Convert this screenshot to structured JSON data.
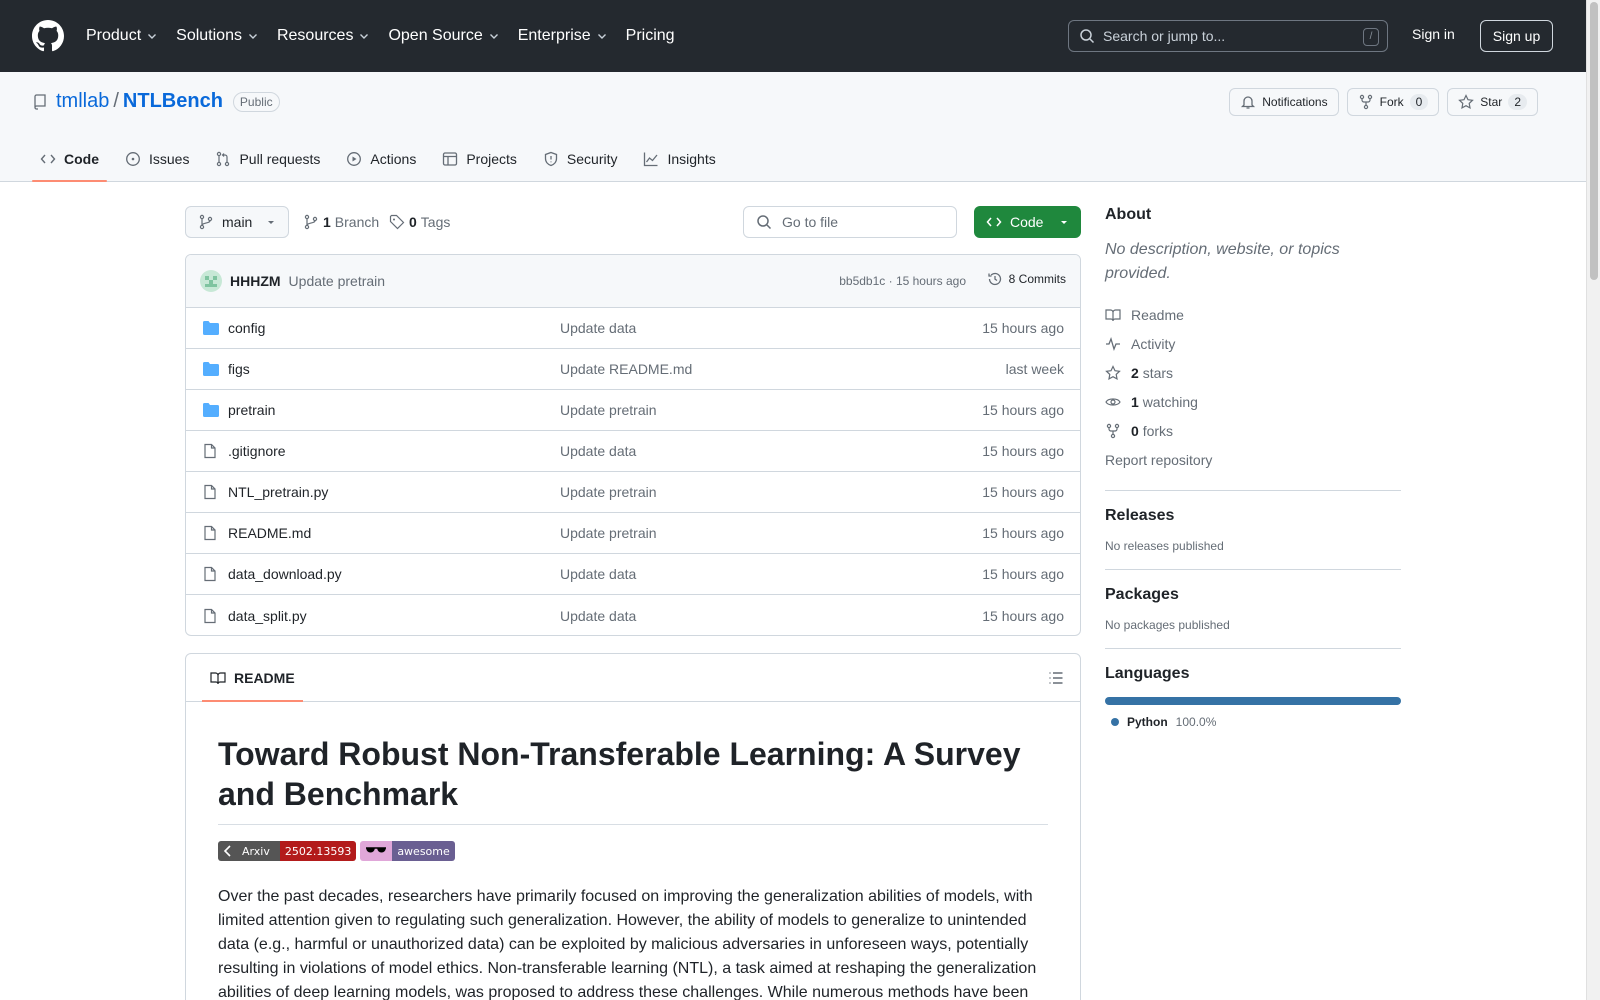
{
  "header": {
    "nav": [
      "Product",
      "Solutions",
      "Resources",
      "Open Source",
      "Enterprise",
      "Pricing"
    ],
    "search_placeholder": "Search or jump to...",
    "search_shortcut": "/",
    "signin": "Sign in",
    "signup": "Sign up"
  },
  "repo": {
    "owner": "tmllab",
    "sep": "/",
    "name": "NTLBench",
    "visibility": "Public",
    "notifications": "Notifications",
    "fork_label": "Fork",
    "fork_count": "0",
    "star_label": "Star",
    "star_count": "2",
    "tabs": [
      "Code",
      "Issues",
      "Pull requests",
      "Actions",
      "Projects",
      "Security",
      "Insights"
    ]
  },
  "toolbar": {
    "branch": "main",
    "branches_count": "1",
    "branches_label": "Branch",
    "tags_count": "0",
    "tags_label": "Tags",
    "goto_placeholder": "Go to file",
    "code_label": "Code"
  },
  "commit": {
    "author": "HHHZM",
    "message": "Update pretrain",
    "meta": "bb5db1c · 15 hours ago",
    "count": "8 Commits"
  },
  "files": [
    {
      "type": "dir",
      "name": "config",
      "msg": "Update data",
      "age": "15 hours ago"
    },
    {
      "type": "dir",
      "name": "figs",
      "msg": "Update README.md",
      "age": "last week"
    },
    {
      "type": "dir",
      "name": "pretrain",
      "msg": "Update pretrain",
      "age": "15 hours ago"
    },
    {
      "type": "file",
      "name": ".gitignore",
      "msg": "Update data",
      "age": "15 hours ago"
    },
    {
      "type": "file",
      "name": "NTL_pretrain.py",
      "msg": "Update pretrain",
      "age": "15 hours ago"
    },
    {
      "type": "file",
      "name": "README.md",
      "msg": "Update pretrain",
      "age": "15 hours ago"
    },
    {
      "type": "file",
      "name": "data_download.py",
      "msg": "Update data",
      "age": "15 hours ago"
    },
    {
      "type": "file",
      "name": "data_split.py",
      "msg": "Update data",
      "age": "15 hours ago"
    }
  ],
  "readme": {
    "tab": "README",
    "title": "Toward Robust Non-Transferable Learning: A Survey and Benchmark",
    "badge1_left": "Arxiv",
    "badge1_right": "2502.13593",
    "badge2_right": "awesome",
    "paragraph": "Over the past decades, researchers have primarily focused on improving the generalization abilities of models, with limited attention given to regulating such generalization. However, the ability of models to generalize to unintended data (e.g., harmful or unauthorized data) can be exploited by malicious adversaries in unforeseen ways, potentially resulting in violations of model ethics. Non-transferable learning (NTL), a task aimed at reshaping the generalization abilities of deep learning models, was proposed to address these challenges. While numerous methods have been"
  },
  "about": {
    "title": "About",
    "description": "No description, website, or topics provided.",
    "readme": "Readme",
    "activity": "Activity",
    "stars_count": "2",
    "stars_label": "stars",
    "watching_count": "1",
    "watching_label": "watching",
    "forks_count": "0",
    "forks_label": "forks",
    "report": "Report repository"
  },
  "releases": {
    "title": "Releases",
    "empty": "No releases published"
  },
  "packages": {
    "title": "Packages",
    "empty": "No packages published"
  },
  "languages": {
    "title": "Languages",
    "items": [
      {
        "name": "Python",
        "percent": "100.0%",
        "color": "#3572A5",
        "fraction": 1.0
      }
    ]
  },
  "colors": {
    "header_bg": "#24292f",
    "accent": "#0969da",
    "code_button": "#1f883d",
    "tab_underline": "#fd8c73"
  }
}
